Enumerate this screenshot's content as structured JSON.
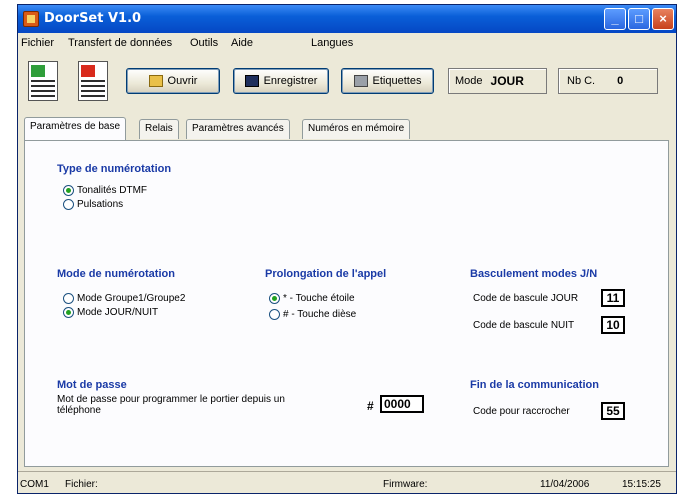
{
  "window": {
    "title": "DoorSet V1.0"
  },
  "titlebar_buttons": {
    "minimize": "_",
    "maximize": "□",
    "close": "×"
  },
  "menu": [
    "Fichier",
    "Transfert de données",
    "Outils",
    "Aide",
    "Langues"
  ],
  "toolbar": {
    "open_label": "Ouvrir",
    "save_label": "Enregistrer",
    "labels_label": "Etiquettes",
    "mode_label": "Mode",
    "mode_value": "JOUR",
    "count_label": "Nb C.",
    "count_value": "0"
  },
  "tabs": [
    "Paramètres de base",
    "Relais",
    "Paramètres avancés",
    "Numéros en mémoire"
  ],
  "sections": {
    "dial_type": {
      "title": "Type de numérotation",
      "options": [
        "Tonalités DTMF",
        "Pulsations"
      ],
      "selected": 0
    },
    "dial_mode": {
      "title": "Mode de numérotation",
      "options": [
        "Mode Groupe1/Groupe2",
        "Mode JOUR/NUIT"
      ],
      "selected": 1
    },
    "call_extension": {
      "title": "Prolongation de l'appel",
      "options": [
        "* - Touche étoile",
        "# - Touche dièse"
      ],
      "selected": 0
    },
    "day_night_switch": {
      "title": "Basculement modes J/N",
      "day_label": "Code de bascule JOUR",
      "day_value": "11",
      "night_label": "Code de bascule NUIT",
      "night_value": "10"
    },
    "password": {
      "title": "Mot de passe",
      "description": "Mot de passe pour programmer le portier depuis un téléphone",
      "prefix": "#",
      "value": "0000"
    },
    "end_call": {
      "title": "Fin de la communication",
      "hangup_label": "Code pour raccrocher",
      "hangup_value": "55"
    }
  },
  "status": {
    "port": "COM1",
    "file": "Fichier:",
    "firmware": "Firmware:",
    "date": "11/04/2006",
    "time": "15:15:25"
  },
  "colors": {
    "heading": "#1a3aa6",
    "titlebar": "#0a5fd8",
    "radio_on": "#21a121"
  }
}
